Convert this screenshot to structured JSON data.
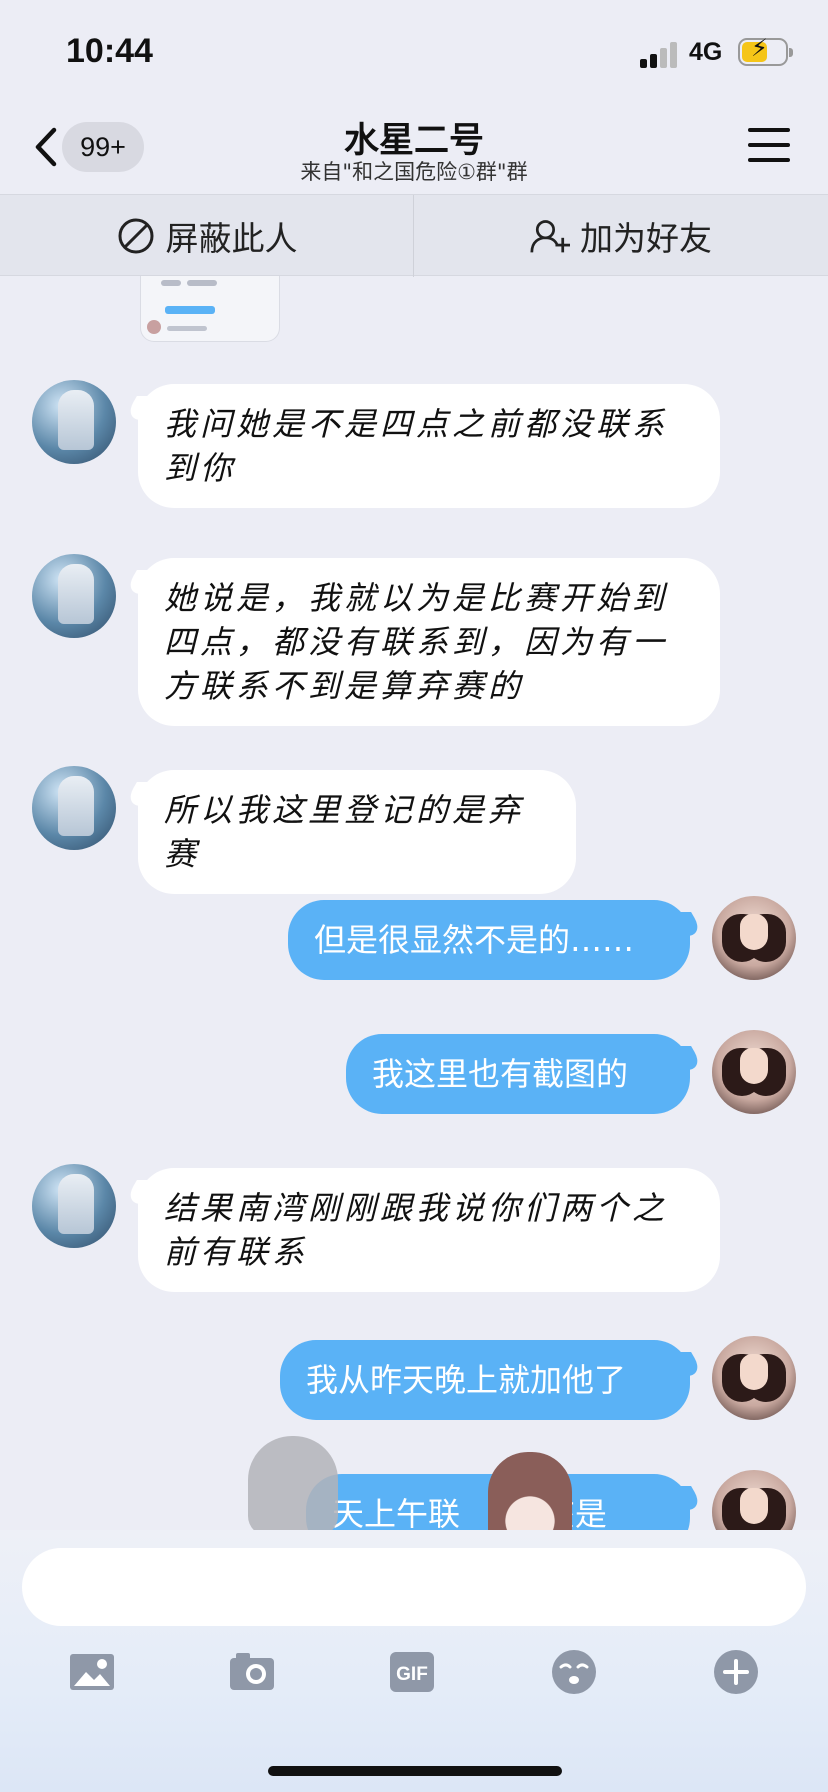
{
  "status_bar": {
    "time": "10:44",
    "network": "4G",
    "battery_level": 0.6
  },
  "nav": {
    "unread_badge": "99+",
    "title": "水星二号",
    "subtitle": "来自\"和之国危险①群\"群"
  },
  "actions": {
    "block_label": "屏蔽此人",
    "add_friend_label": "加为好友"
  },
  "messages": [
    {
      "side": "left",
      "text": "我问她是不是四点之前都没联系到你"
    },
    {
      "side": "left",
      "text": "她说是，我就以为是比赛开始到四点，都没有联系到，因为有一方联系不到是算弃赛的"
    },
    {
      "side": "left",
      "text": "所以我这里登记的是弃赛"
    },
    {
      "side": "right",
      "text": "但是很显然不是的……"
    },
    {
      "side": "right",
      "text": "我这里也有截图的"
    },
    {
      "side": "left",
      "text": "结果南湾刚刚跟我说你们两个之前有联系"
    },
    {
      "side": "right",
      "text": "我从昨天晚上就加他了"
    },
    {
      "side": "right",
      "text": "天上午联     应该是"
    }
  ],
  "input": {
    "placeholder": ""
  },
  "toolbar": {
    "icons": [
      "image-icon",
      "camera-icon",
      "gif-icon",
      "emoji-icon",
      "plus-icon"
    ],
    "gif_label": "GIF"
  },
  "colors": {
    "background": "#ecedf5",
    "bubble_self": "#5ab2f6",
    "bubble_other": "#ffffff"
  }
}
